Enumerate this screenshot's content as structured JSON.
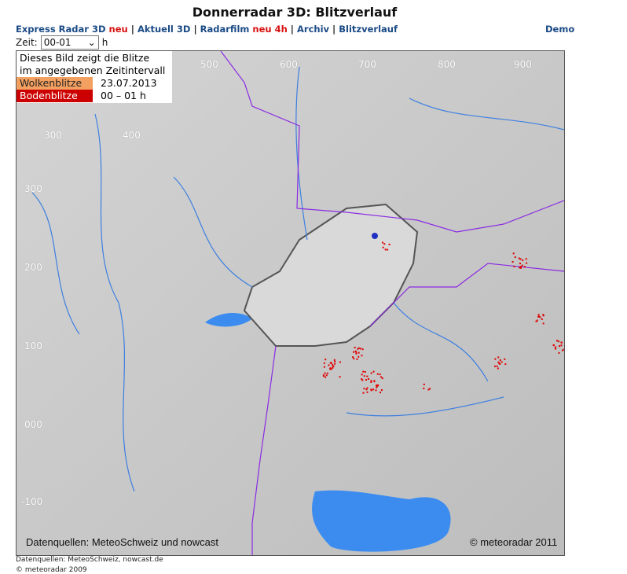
{
  "title": "Donnerradar 3D: Blitzverlauf",
  "nav": {
    "express": "Express Radar 3D",
    "express_new": "neu",
    "aktuell": "Aktuell 3D",
    "radarfilm": "Radarfilm",
    "radarfilm_new": "neu 4h",
    "archiv": "Archiv",
    "blitzverlauf": "Blitzverlauf",
    "sep": "|",
    "demo": "Demo"
  },
  "zeit": {
    "label": "Zeit:",
    "value": "00-01",
    "unit": "h"
  },
  "legend": {
    "line1": "Dieses Bild zeigt die Blitze",
    "line2": "im angegebenen Zeitintervall",
    "wolken": "Wolkenblitze",
    "boden": "Bodenblitze",
    "date": "23.07.2013",
    "interval": "00 – 01 h",
    "wolken_color": "#f4a060",
    "boden_color": "#cc0000"
  },
  "axes": {
    "top": [
      "500",
      "600",
      "700",
      "800",
      "900"
    ],
    "inner": [
      "300",
      "400"
    ],
    "left": [
      "300",
      "200",
      "100",
      "000",
      "-100"
    ]
  },
  "map": {
    "source": "Datenquellen: MeteoSchweiz und nowcast",
    "copyright": "© meteoradar 2011"
  },
  "footer": {
    "sources": "Datenquellen: MeteoSchweiz, nowcast.de",
    "copyright": "© meteoradar 2009"
  }
}
